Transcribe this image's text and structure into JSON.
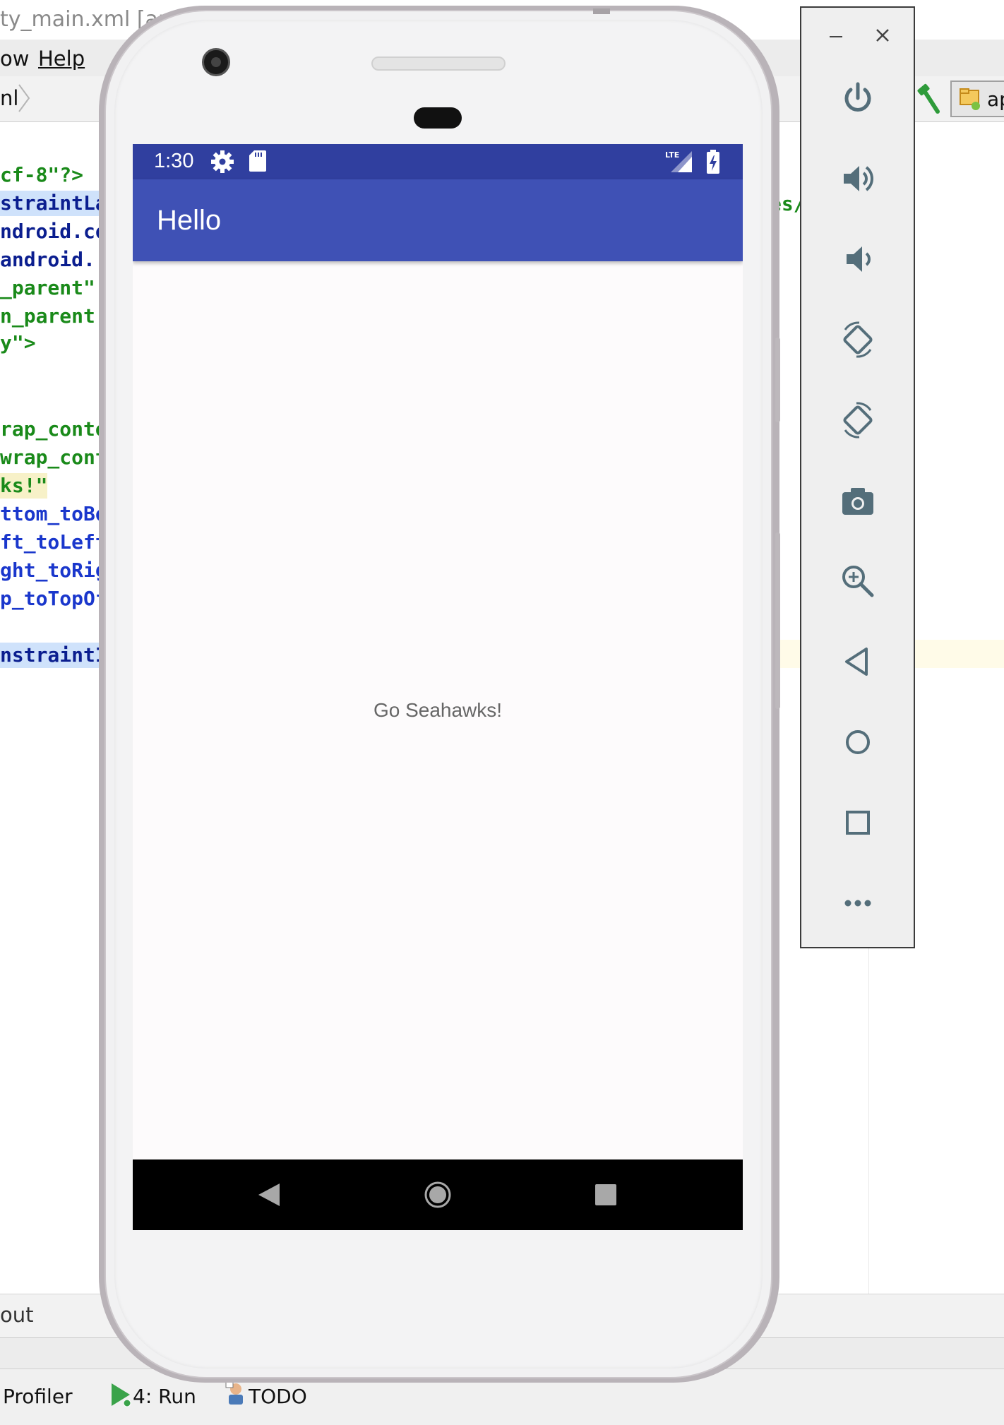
{
  "ide": {
    "title_fragment": "ty_main.xml [ap",
    "menu": {
      "window_fragment": "ow",
      "help": "Help"
    },
    "breadcrumb_fragment": "nl",
    "app_config_fragment": "ap",
    "code_lines": [
      "cf-8\"?>",
      "straintLa",
      "ndroid.co",
      " android.",
      "_parent\"",
      "n_parent'",
      "y\">",
      "rap_conte",
      "wrap_cont",
      "ks!\"",
      "ttom_toBo",
      "ft_toLeft",
      "ght_toRig",
      "p_toTopOf",
      "nstraintI"
    ],
    "right_code_fragment": "es/",
    "bottom_panel_fragment": "out",
    "tool_windows": {
      "profiler": "Profiler",
      "run": "4: Run",
      "todo": "TODO"
    }
  },
  "emulator": {
    "status_bar": {
      "time": "1:30",
      "network": "LTE"
    },
    "app_bar": {
      "title": "Hello"
    },
    "content": {
      "text": "Go Seahawks!"
    },
    "colors": {
      "status_bar": "#303f9f",
      "app_bar": "#3f51b5",
      "nav_bar": "#000000"
    }
  },
  "emulator_controls": {
    "window": [
      "minimize-icon",
      "close-icon"
    ],
    "buttons": [
      "power-icon",
      "volume-up-icon",
      "volume-down-icon",
      "rotate-left-icon",
      "rotate-right-icon",
      "camera-icon",
      "zoom-icon",
      "back-icon",
      "home-icon",
      "overview-icon",
      "more-icon"
    ]
  }
}
